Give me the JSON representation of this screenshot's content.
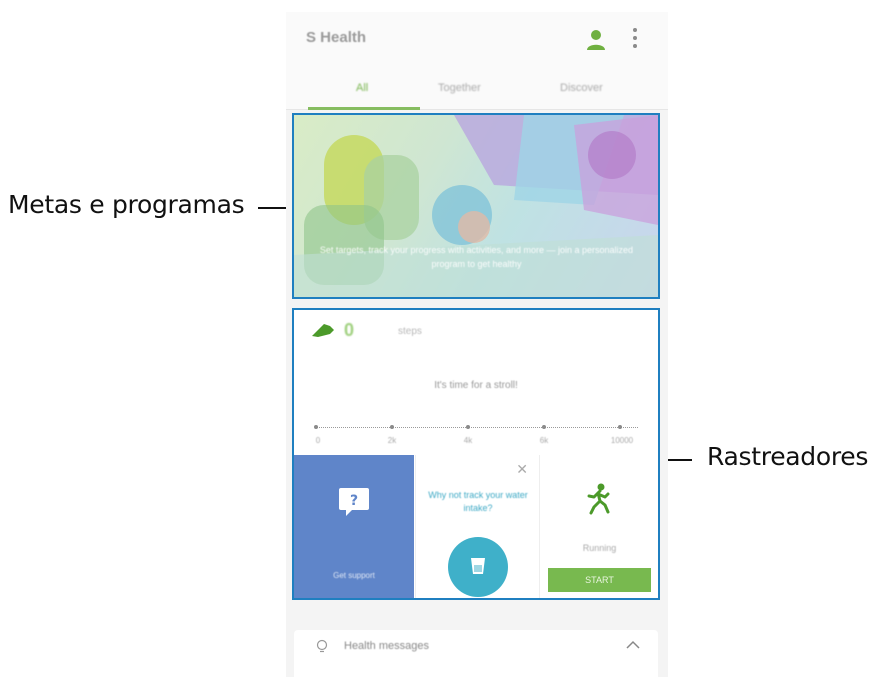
{
  "callouts": {
    "left_label": "Metas e programas",
    "right_label": "Rastreadores"
  },
  "appbar": {
    "title": "S Health",
    "profile_icon": "person-icon",
    "more_icon": "more-vertical-icon"
  },
  "tabs": [
    {
      "label": "All",
      "active": true
    },
    {
      "label": "Together",
      "active": false
    },
    {
      "label": "Discover",
      "active": false
    }
  ],
  "banner": {
    "text": "Set targets, track your progress with activities, and more — join a personalized program to get healthy"
  },
  "steps_tracker": {
    "icon": "shoe-icon",
    "value": "0",
    "unit": "steps",
    "message": "It's time for a stroll!",
    "scale_labels": [
      "0",
      "2k",
      "4k",
      "6k",
      "10000"
    ]
  },
  "tiles": {
    "help": {
      "icon": "question-bubble-icon",
      "label": "Get support"
    },
    "water": {
      "question": "Why not track your water intake?",
      "icon": "cup-icon",
      "close_icon": "close-icon"
    },
    "running": {
      "icon": "runner-icon",
      "label": "Running",
      "button": "START"
    }
  },
  "messages": {
    "icon": "lightbulb-icon",
    "title": "Health messages",
    "chevron_icon": "chevron-up-icon"
  },
  "colors": {
    "accent_green": "#78b94f",
    "callout_blue": "#1f7fc0",
    "tile_blue": "#5f85c9",
    "water_teal": "#3fb0c9"
  }
}
